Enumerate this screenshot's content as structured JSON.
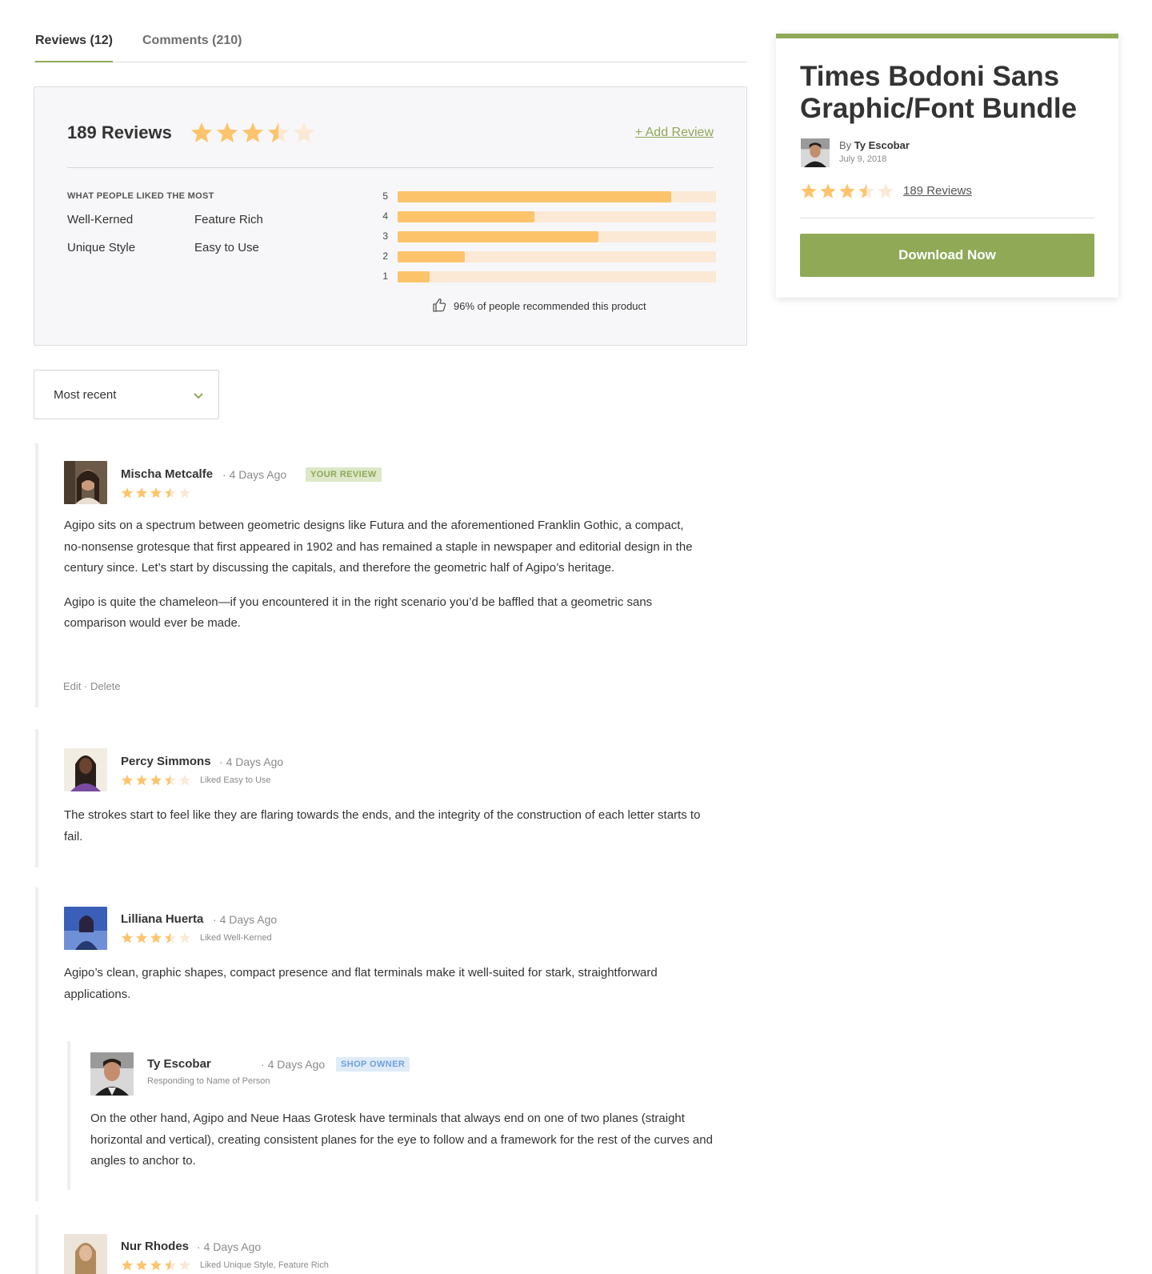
{
  "tabs": [
    {
      "label": "Reviews (12)",
      "active": true
    },
    {
      "label": "Comments (210)",
      "active": false
    }
  ],
  "summary": {
    "count_label": "189 Reviews",
    "rating": 3.5,
    "add_review_label": "+ Add Review",
    "liked_heading": "WHAT PEOPLE LIKED THE MOST",
    "liked": [
      "Well-Kerned",
      "Feature Rich",
      "Unique Style",
      "Easy to Use"
    ],
    "distribution": [
      {
        "stars": "5",
        "fraction": 0.86
      },
      {
        "stars": "4",
        "fraction": 0.43
      },
      {
        "stars": "3",
        "fraction": 0.63
      },
      {
        "stars": "2",
        "fraction": 0.21
      },
      {
        "stars": "1",
        "fraction": 0.1
      }
    ],
    "recommend_text": "96% of people recommended this product"
  },
  "sort": {
    "label": "Most recent"
  },
  "reviews": [
    {
      "name": "Mischa Metcalfe",
      "time": "4 Days Ago",
      "badge": "YOUR REVIEW",
      "rating": 3.5,
      "paragraphs": [
        "Agipo sits on a spectrum between geometric designs like Futura and the aforementioned Franklin Gothic, a compact, no-nonsense grotesque that first appeared in 1902 and has remained a staple in newspaper and editorial design in the century since. Let’s start by discussing the capitals, and therefore the geometric half of Agipo’s heritage.",
        "Agipo is quite the chameleon—if you encountered it in the right scenario you’d be baffled that a geometric sans comparison would ever be made."
      ],
      "edit_label": "Edit",
      "delete_label": "Delete"
    },
    {
      "name": "Percy Simmons",
      "time": "4 Days Ago",
      "rating": 3.5,
      "liked": "Liked Easy to Use",
      "paragraphs": [
        "The strokes start to feel like they are flaring towards the ends, and the integrity of the construction of each letter starts to fail."
      ]
    },
    {
      "name": "Lilliana Huerta",
      "time": "4 Days Ago",
      "rating": 3.5,
      "liked": "Liked Well-Kerned",
      "paragraphs": [
        "Agipo’s clean, graphic shapes, compact presence and flat terminals make it well-suited for stark, straightforward applications."
      ],
      "reply": {
        "name": "Ty Escobar",
        "time": "4 Days Ago",
        "badge": "SHOP OWNER",
        "responding": "Responding to Name of Person",
        "paragraphs": [
          "On the other hand, Agipo and Neue Haas Grotesk have terminals that always end on one of two planes (straight horizontal and vertical), creating consistent planes for the eye to follow and a framework for the rest of the curves and angles to anchor to."
        ]
      }
    },
    {
      "name": "Nur Rhodes",
      "time": "4 Days Ago",
      "rating": 3.5,
      "liked": "Liked Unique Style, Feature Rich"
    }
  ],
  "product": {
    "title": "Times Bodoni Sans Graphic/Font Bundle",
    "by_label": "By",
    "author": "Ty Escobar",
    "date": "July 9, 2018",
    "rating": 3.5,
    "reviews_link": "189 Reviews",
    "download_label": "Download Now"
  },
  "colors": {
    "accent": "#8fa957",
    "star_filled": "#fdc46c",
    "star_empty": "#fbe9d6",
    "bar_fill": "#fdc46c",
    "bar_track": "#fbe9d6",
    "badge_green_bg": "#dce8c7",
    "badge_blue_bg": "#dfebf9"
  }
}
